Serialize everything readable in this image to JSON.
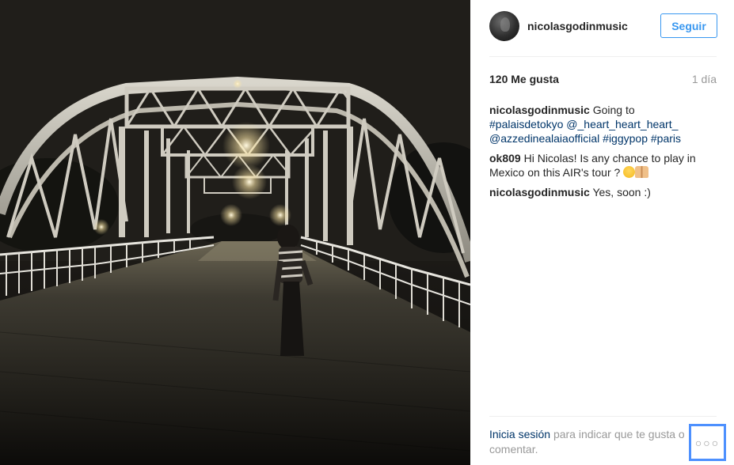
{
  "post": {
    "username": "nicolasgodinmusic",
    "follow_label": "Seguir",
    "likes": "120 Me gusta",
    "time_ago": "1 día"
  },
  "caption": {
    "user": "nicolasgodinmusic",
    "text": "Going to",
    "tags": [
      "#palaisdetokyo",
      "@_heart_heart_heart_",
      "@azzedinealaiaofficial",
      "#iggypop",
      "#paris"
    ]
  },
  "comments": [
    {
      "user": "ok809",
      "text": "Hi Nicolas! Is any chance to play in Mexico on this AIR's tour ?",
      "emojis": [
        "smiling-face-emoji",
        "praying-hands-emoji"
      ]
    },
    {
      "user": "nicolasgodinmusic",
      "text": "Yes, soon :)"
    }
  ],
  "footer": {
    "login_link": "Inicia sesión",
    "prompt": "para indicar que te gusta o comentar.",
    "more_label": "○○○"
  },
  "colors": {
    "accent": "#3897f0",
    "link": "#003569",
    "muted": "#999999",
    "focus_ring": "#4d90fe"
  },
  "icons": {
    "more": "more-options-icon"
  }
}
